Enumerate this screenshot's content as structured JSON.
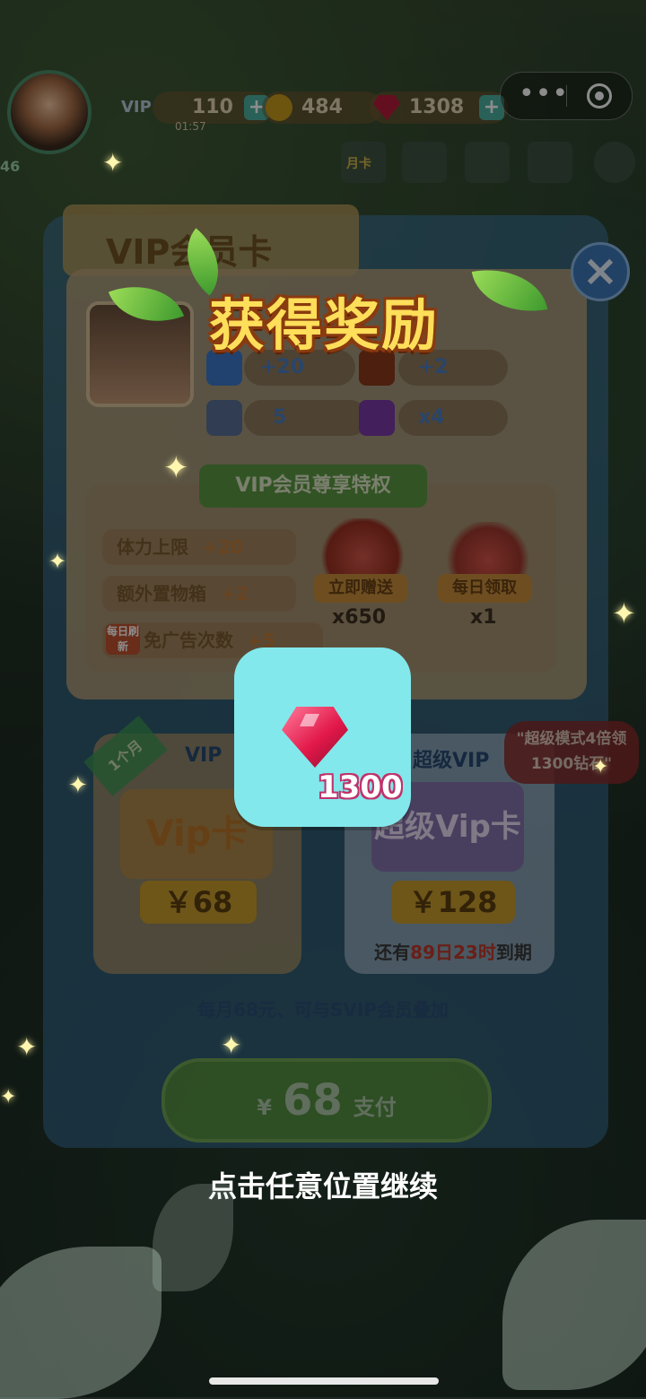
{
  "hud": {
    "level": "46",
    "vip_tag": "VIP",
    "energy": "110",
    "energy_timer": "01:57",
    "coins": "484",
    "rubies": "1308",
    "plus": "+",
    "monthly_card": "月卡"
  },
  "capsule": {
    "more": "•••"
  },
  "panel": {
    "title": "VIP会员卡",
    "stats": [
      "+20",
      "+2",
      "5",
      "x4"
    ],
    "privilege_header": "VIP会员尊享特权",
    "privileges": [
      {
        "label": "体力上限",
        "value": "+20"
      },
      {
        "label": "额外置物箱",
        "value": "+2"
      },
      {
        "label": "免广告次数",
        "value": "+5",
        "tag": "每日刷新"
      }
    ],
    "gifts": [
      {
        "label": "立即赠送",
        "count": "x650"
      },
      {
        "label": "每日领取",
        "count": "x1"
      }
    ],
    "vip_card": {
      "title": "VIP",
      "badge": "1个月",
      "art": "Vip卡",
      "price": "￥68"
    },
    "svip_card": {
      "title": "超级VIP",
      "art": "超级Vip卡",
      "price": "￥128",
      "expire_prefix": "还有",
      "expire_days": "89日",
      "expire_hours": "23时",
      "expire_suffix": "到期"
    },
    "bubble": "\"超级模式4倍领1300钻石\"",
    "note": "每月68元、可与SVIP会员叠加",
    "pay": {
      "currency": "¥",
      "amount": "68",
      "label": "支付"
    }
  },
  "reward": {
    "title": "获得奖励",
    "item": "ruby",
    "quantity": "1300",
    "hint": "点击任意位置继续"
  },
  "colors": {
    "tile": "#83e8ec",
    "title": "#ffde5a",
    "gem": "#e2184a"
  }
}
